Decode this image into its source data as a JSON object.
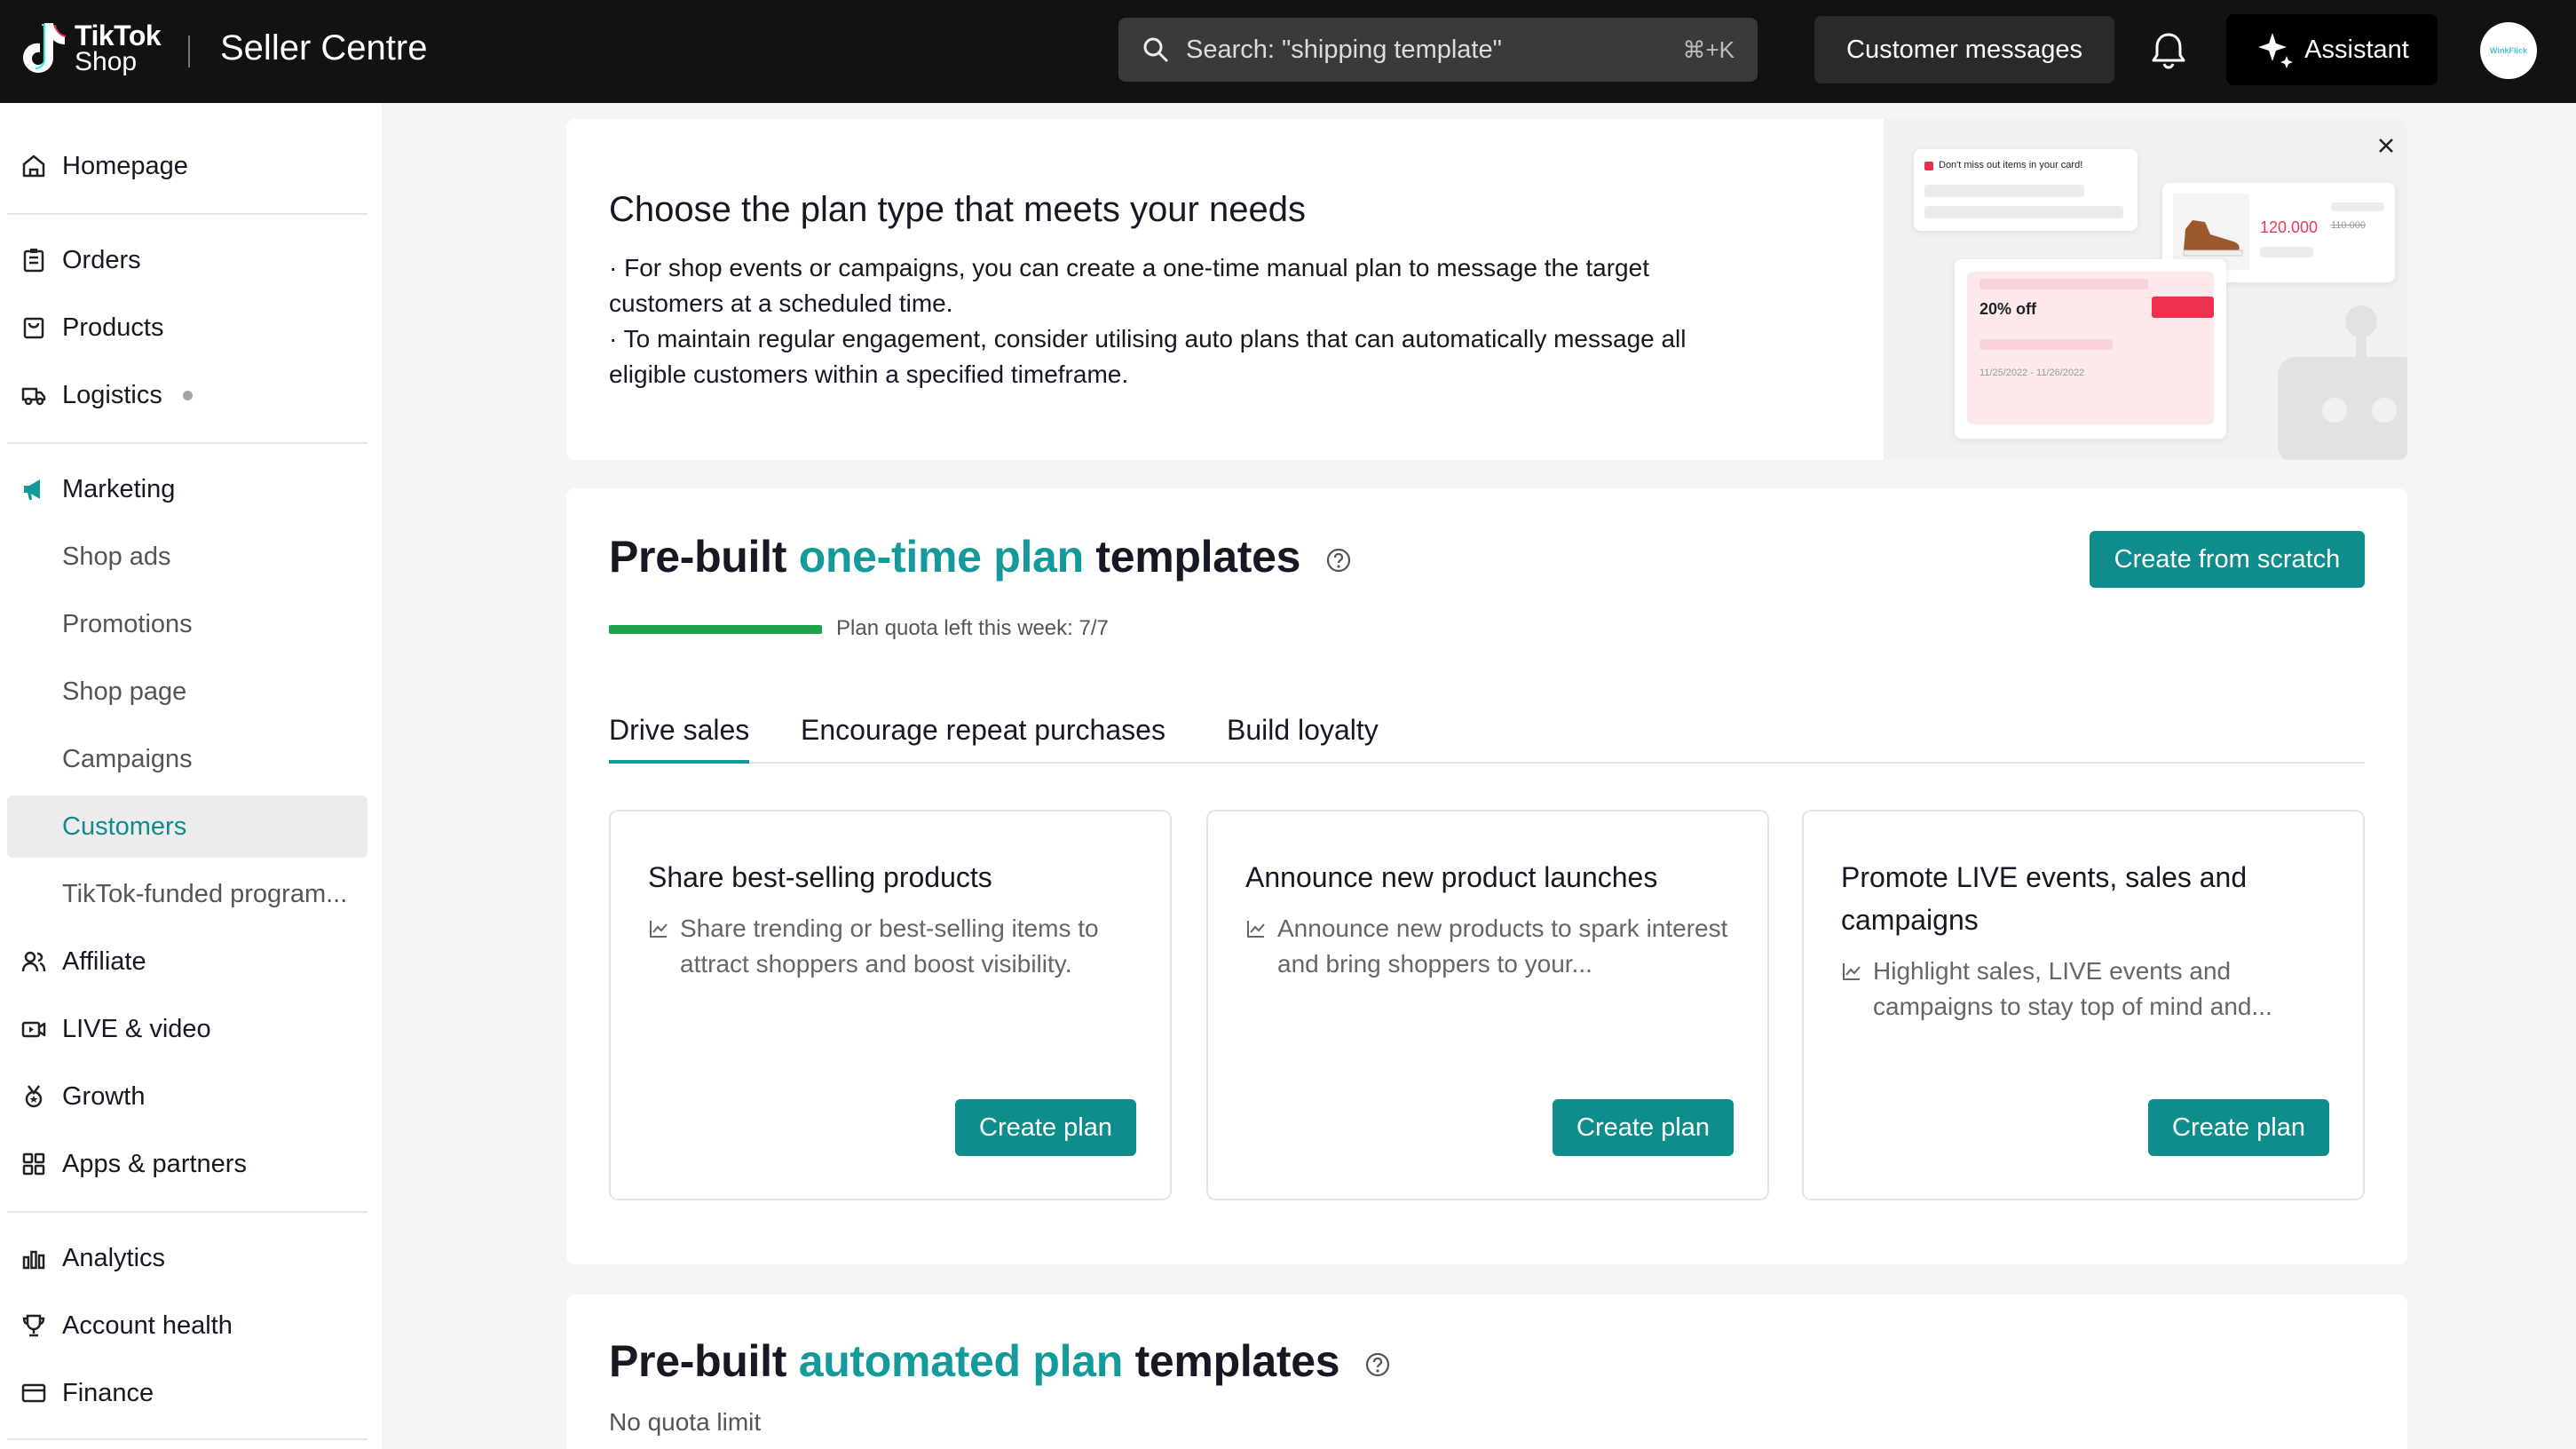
{
  "topbar": {
    "logo_line1": "TikTok",
    "logo_line2": "Shop",
    "app_title": "Seller Centre",
    "search_placeholder": "Search: \"shipping template\"",
    "search_shortcut": "⌘+K",
    "customer_messages": "Customer messages",
    "assistant": "Assistant",
    "avatar_text": "WinkFlick"
  },
  "sidebar": {
    "items": [
      {
        "label": "Homepage",
        "icon": "home-icon"
      },
      {
        "label": "Orders",
        "icon": "clipboard-icon"
      },
      {
        "label": "Products",
        "icon": "bag-icon"
      },
      {
        "label": "Logistics",
        "icon": "truck-icon"
      },
      {
        "label": "Marketing",
        "icon": "megaphone-icon"
      },
      {
        "label": "Shop ads"
      },
      {
        "label": "Promotions"
      },
      {
        "label": "Shop page"
      },
      {
        "label": "Campaigns"
      },
      {
        "label": "Customers"
      },
      {
        "label": "TikTok-funded program..."
      },
      {
        "label": "Affiliate",
        "icon": "people-icon"
      },
      {
        "label": "LIVE & video",
        "icon": "video-icon"
      },
      {
        "label": "Growth",
        "icon": "medal-icon"
      },
      {
        "label": "Apps & partners",
        "icon": "grid-icon"
      },
      {
        "label": "Analytics",
        "icon": "bar-chart-icon"
      },
      {
        "label": "Account health",
        "icon": "trophy-icon"
      },
      {
        "label": "Finance",
        "icon": "card-icon"
      }
    ],
    "active": "Customers"
  },
  "banner": {
    "title": "Choose the plan type that meets your needs",
    "line1": "· For shop events or campaigns, you can create a one-time manual plan to message the target customers at a scheduled time.",
    "line2": "· To maintain regular engagement, consider utilising auto plans that can automatically message all eligible customers within a specified timeframe.",
    "illus_cart_text": "Don't miss out items in your card!",
    "illus_price": "120.000",
    "illus_old_price": "110.000",
    "illus_discount": "20% off",
    "illus_dates": "11/25/2022 - 11/26/2022"
  },
  "one_time": {
    "title_pre": "Pre-built",
    "title_accent": "one-time plan",
    "title_post": "templates",
    "create_from_scratch": "Create from scratch",
    "quota_text": "Plan quota left this week: 7/7",
    "quota_fraction": 1.0,
    "tabs": [
      "Drive sales",
      "Encourage repeat purchases",
      "Build loyalty"
    ],
    "active_tab": "Drive sales",
    "cards": [
      {
        "title": "Share best-selling products",
        "desc": "Share trending or best-selling items to attract shoppers and boost visibility.",
        "button": "Create plan"
      },
      {
        "title": "Announce new product launches",
        "desc": "Announce new products to spark interest and bring shoppers to your...",
        "button": "Create plan"
      },
      {
        "title": "Promote LIVE events, sales and campaigns",
        "desc": "Highlight sales, LIVE events and campaigns to stay top of mind and...",
        "button": "Create plan"
      }
    ]
  },
  "automated": {
    "title_pre": "Pre-built",
    "title_accent": "automated plan",
    "title_post": "templates",
    "subtitle": "No quota limit"
  },
  "colors": {
    "accent": "#149a9a",
    "button": "#0f8c8c",
    "quota": "#1da14a",
    "topbar": "#121212"
  }
}
